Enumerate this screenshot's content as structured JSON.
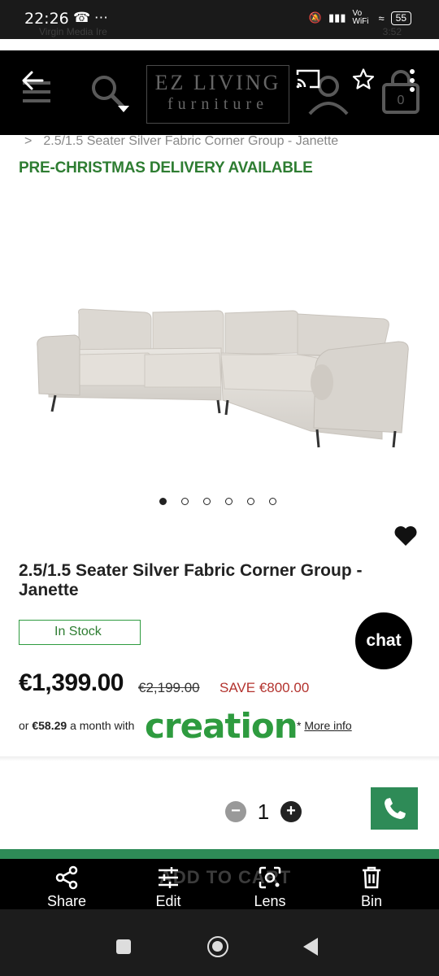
{
  "status": {
    "time": "22:26",
    "battery": "55",
    "network": "Vo WiFi"
  },
  "ghost_status": {
    "carrier": "Virgin Media Ire",
    "time": "3:52"
  },
  "header": {
    "logo_line1": "EZ LIVING",
    "logo_line2": "furniture"
  },
  "breadcrumb": {
    "separator": ">",
    "current": "2.5/1.5 Seater Silver Fabric Corner Group - Janette"
  },
  "banner": "PRE-CHRISTMAS DELIVERY AVAILABLE",
  "carousel": {
    "count": 6,
    "active": 0
  },
  "product": {
    "title": "2.5/1.5 Seater Silver Fabric Corner Group - Janette",
    "stock": "In Stock",
    "price": "€1,399.00",
    "old_price": "€2,199.00",
    "save": "SAVE €800.00",
    "finance_prefix": "or",
    "finance_amount": "€58.29",
    "finance_suffix": "a month with",
    "finance_brand": "creation",
    "more_info_prefix": "*",
    "more_info_link": "More info",
    "quantity": "1"
  },
  "chat_label": "chat",
  "cart_ghost_label": "ADD TO CART",
  "actions": [
    {
      "label": "Share",
      "icon": "share-icon"
    },
    {
      "label": "Edit",
      "icon": "sliders-icon"
    },
    {
      "label": "Lens",
      "icon": "lens-icon"
    },
    {
      "label": "Bin",
      "icon": "trash-icon"
    }
  ],
  "colors": {
    "brand_green": "#2e7d32",
    "save_red": "#b3332e",
    "button_green": "#2e8b57"
  }
}
